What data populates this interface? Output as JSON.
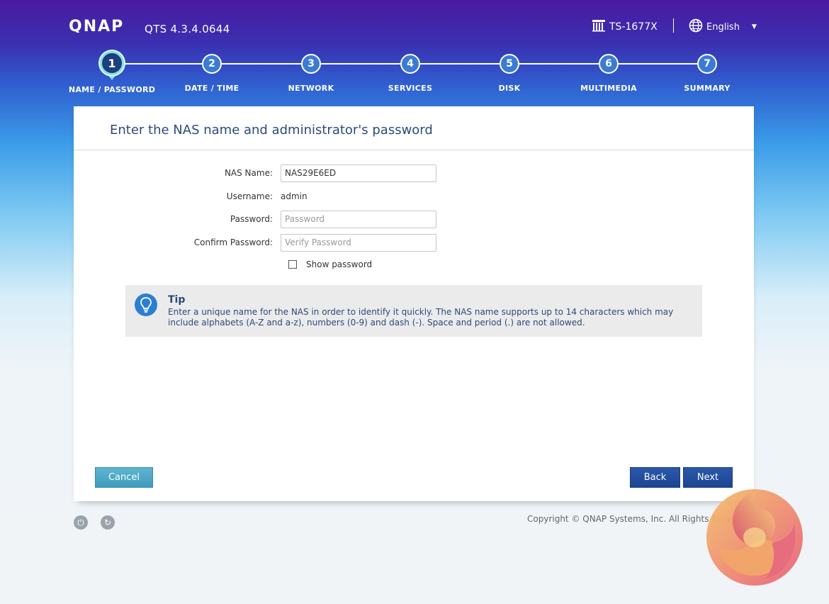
{
  "header": {
    "brand": "QNAP",
    "version": "QTS 4.3.4.0644",
    "model": "TS-1677X",
    "language": "English"
  },
  "steps": [
    {
      "number": "1",
      "label": "NAME / PASSWORD",
      "active": true
    },
    {
      "number": "2",
      "label": "DATE / TIME"
    },
    {
      "number": "3",
      "label": "NETWORK"
    },
    {
      "number": "4",
      "label": "SERVICES"
    },
    {
      "number": "5",
      "label": "DISK"
    },
    {
      "number": "6",
      "label": "MULTIMEDIA"
    },
    {
      "number": "7",
      "label": "SUMMARY"
    }
  ],
  "form": {
    "title": "Enter the NAS name and administrator's password",
    "nas_name_label": "NAS Name:",
    "nas_name_value": "NAS29E6ED",
    "username_label": "Username:",
    "username_value": "admin",
    "password_label": "Password:",
    "password_placeholder": "Password",
    "confirm_label": "Confirm Password:",
    "confirm_placeholder": "Verify Password",
    "show_password_label": "Show password"
  },
  "tip": {
    "title": "Tip",
    "text": "Enter a unique name for the NAS in order to identify it quickly. The NAS name supports up to 14 characters which may include alphabets (A-Z and a-z), numbers (0-9) and dash (-). Space and period (.) are not allowed."
  },
  "buttons": {
    "cancel": "Cancel",
    "back": "Back",
    "next": "Next"
  },
  "footer": {
    "copyright": "Copyright © QNAP Systems, Inc. All Rights Reserved."
  },
  "icons": {
    "model": "nas-device-icon",
    "language": "globe-icon",
    "tip": "lightbulb-icon",
    "power": "power-icon",
    "restart": "restart-icon"
  }
}
